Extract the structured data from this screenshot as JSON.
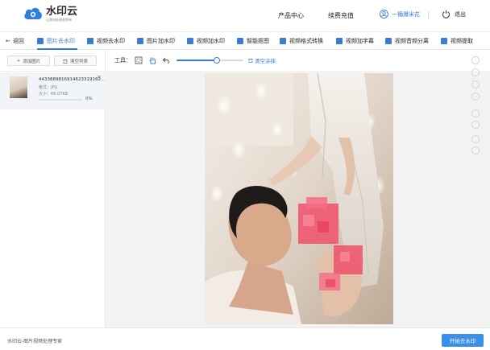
{
  "header": {
    "logo_title": "水印云",
    "logo_sub": "让素材处理更简单",
    "nav": [
      "产品中心",
      "续费充值"
    ],
    "user_name": "一桶爆米花",
    "logout": "退出"
  },
  "tabs": {
    "back": "返回",
    "items": [
      {
        "label": "图片去水印",
        "active": true
      },
      {
        "label": "视频去水印"
      },
      {
        "label": "图片加水印"
      },
      {
        "label": "视频加水印"
      },
      {
        "label": "智能抠图"
      },
      {
        "label": "视频格式转换"
      },
      {
        "label": "视频加字幕"
      },
      {
        "label": "视频音频分离"
      },
      {
        "label": "视频提取"
      }
    ]
  },
  "sidebar": {
    "add_button": "添加图片",
    "clear_button": "清空列表",
    "file": {
      "name": "4433889816914623319162...",
      "format": "格式：JPG",
      "size": "大小：66.07KB",
      "progress_pct": 0,
      "progress_label": "0%"
    }
  },
  "toolbar": {
    "label": "工具：",
    "brush_size_fraction": 0.6,
    "clear_mark": "清空涂抹"
  },
  "footer": {
    "text": "水印云-图片视频处理专家",
    "start_button": "开始去水印"
  },
  "colors": {
    "accent": "#3a7bd5",
    "button": "#3a90e8",
    "mosaic": "#f0506b"
  }
}
